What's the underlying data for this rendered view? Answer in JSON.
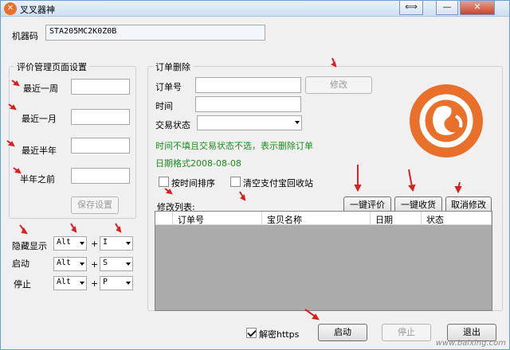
{
  "window": {
    "title": "叉叉器神",
    "btn_restore": "⟺",
    "btn_min": "—",
    "btn_close": "✕"
  },
  "machine": {
    "label": "机器码",
    "value": "STA205MC2K0Z0B"
  },
  "eval_group": {
    "title": "评价管理页面设置",
    "rows": [
      "最近一周",
      "最近一月",
      "最近半年",
      "半年之前"
    ],
    "save_label": "保存设置"
  },
  "hotkeys": [
    {
      "label": "隐藏显示",
      "mod": "Alt",
      "key": "I"
    },
    {
      "label": "启动",
      "mod": "Alt",
      "key": "S"
    },
    {
      "label": "停止",
      "mod": "Alt",
      "key": "P"
    }
  ],
  "hotkey_plus": "+",
  "order_group": {
    "title": "订单删除",
    "order_no_label": "订单号",
    "modify_label": "修改",
    "time_label": "时间",
    "status_label": "交易状态",
    "hint": "时间不填且交易状态不选，表示删除订单",
    "date_format": "日期格式2008-08-08"
  },
  "options": {
    "sort_by_time": "按时间排序",
    "clear_recycle": "清空支付宝回收站"
  },
  "actions": {
    "one_eval": "一键评价",
    "one_receive": "一键收货",
    "cancel_modify": "取消修改"
  },
  "list": {
    "title": "修改列表:",
    "columns": [
      "订单号",
      "宝贝名称",
      "日期",
      "状态"
    ]
  },
  "bottom": {
    "decrypt_label": "解密https",
    "start": "启动",
    "stop": "停止",
    "exit": "退出"
  },
  "watermark": "www.baixing.com",
  "colors": {
    "accent": "#e8702a",
    "hint": "#1a8f1a",
    "arrow": "#d8201e"
  }
}
